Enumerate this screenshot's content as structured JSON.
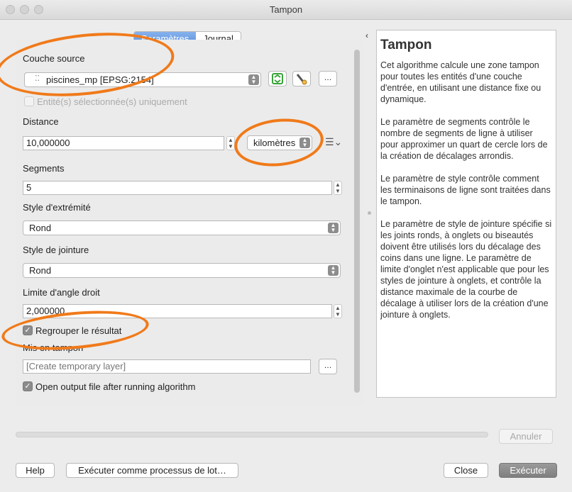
{
  "window": {
    "title": "Tampon"
  },
  "tabs": [
    {
      "label": "Paramètres",
      "active": true
    },
    {
      "label": "Journal",
      "active": false
    }
  ],
  "params": {
    "source_layer": {
      "label": "Couche source",
      "value": "piscines_mp [EPSG:2154]"
    },
    "selected_only": {
      "label": "Entité(s) sélectionnée(s) uniquement",
      "checked": false
    },
    "distance": {
      "label": "Distance",
      "value": "10,000000",
      "unit": "kilomètres"
    },
    "segments": {
      "label": "Segments",
      "value": "5"
    },
    "end_cap": {
      "label": "Style d'extrémité",
      "value": "Rond"
    },
    "join_style": {
      "label": "Style de jointure",
      "value": "Rond"
    },
    "miter_limit": {
      "label": "Limite d'angle droit",
      "value": "2,000000"
    },
    "dissolve": {
      "label": "Regrouper le résultat",
      "checked": true
    },
    "output": {
      "label": "Mis en tampon",
      "placeholder": "[Create temporary layer]"
    },
    "open_output": {
      "label": "Open output file after running algorithm",
      "checked": true
    }
  },
  "help": {
    "title": "Tampon",
    "paragraphs": [
      "Cet algorithme calcule une zone tampon pour toutes les entités d'une couche d'entrée, en utilisant une distance fixe ou dynamique.",
      "Le paramètre de segments contrôle le nombre de segments de ligne à utiliser pour approximer un quart de cercle lors de la création de décalages arrondis.",
      "Le paramètre de style contrôle comment les terminaisons de ligne sont traitées dans le tampon.",
      "Le paramètre de style de jointure spécifie si les joints ronds, à onglets ou biseautés doivent être utilisés lors du décalage des coins dans une ligne. Le paramètre de limite d'onglet n'est applicable que pour les styles de jointure à onglets, et contrôle la distance maximale de la courbe de décalage à utiliser lors de la création d'une jointure à onglets."
    ]
  },
  "buttons": {
    "cancel": "Annuler",
    "help": "Help",
    "batch": "Exécuter comme processus de lot…",
    "close": "Close",
    "run": "Exécuter"
  },
  "small_buttons": {
    "ellipsis": "…"
  },
  "accent_colors": {
    "highlight_ring": "#f07a1a",
    "tab_active": "#5b8fd9"
  }
}
